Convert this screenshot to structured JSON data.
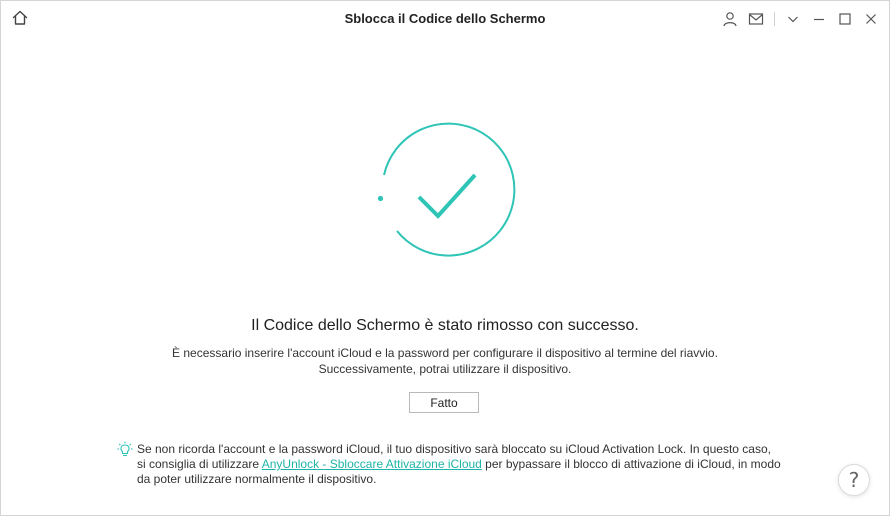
{
  "window": {
    "title": "Sblocca il Codice dello Schermo"
  },
  "icons": {
    "home": "home-icon",
    "account": "user-icon",
    "mail": "mail-icon",
    "menu": "chevron-down-icon",
    "minimize": "minimize-icon",
    "maximize": "maximize-icon",
    "close": "close-icon",
    "success": "checkmark-circle-icon",
    "tip": "lightbulb-icon",
    "help": "help-icon"
  },
  "colors": {
    "accent": "#2ec4b6",
    "link": "#1fb4a8"
  },
  "main": {
    "headline": "Il Codice dello Schermo è stato rimosso con successo.",
    "description_line1": "È necessario inserire l'account iCloud e la password per configurare il dispositivo al termine del riavvio.",
    "description_line2": "Successivamente, potrai utilizzare il dispositivo.",
    "done_label": "Fatto"
  },
  "tip": {
    "text_before": "Se non ricorda l'account e la password iCloud, il tuo dispositivo sarà bloccato su iCloud Activation Lock. In questo caso, si consiglia di utilizzare ",
    "link_text": "AnyUnlock - Sbloccare Attivazione iCloud",
    "text_after": " per bypassare il blocco di attivazione di iCloud, in modo da poter utilizzare normalmente il dispositivo."
  },
  "help": {
    "label": "?"
  }
}
